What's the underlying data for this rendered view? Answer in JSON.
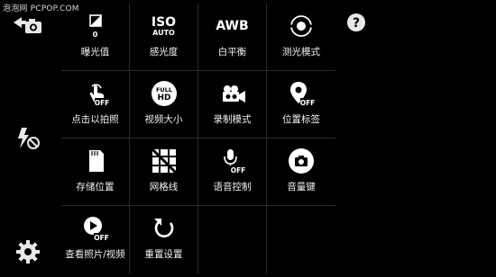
{
  "watermark": "泡泡网 PCPOP.COM",
  "sidebar": {
    "switch_camera": "switch-camera-icon",
    "flash": "flash-off-icon",
    "settings": "settings-icon"
  },
  "help": "help-icon",
  "settings_grid": [
    {
      "label": "曝光值",
      "icon": "exposure-icon",
      "value_text": "0"
    },
    {
      "label": "感光度",
      "icon": "iso-icon",
      "icon_text": "ISO",
      "value_text": "AUTO"
    },
    {
      "label": "白平衡",
      "icon": "white-balance-icon",
      "icon_text": "AWB"
    },
    {
      "label": "测光模式",
      "icon": "metering-icon"
    },
    {
      "label": "点击以拍照",
      "icon": "touch-capture-icon",
      "badge": "OFF"
    },
    {
      "label": "视频大小",
      "icon": "video-size-icon",
      "icon_text": "FULL",
      "value_text": "HD"
    },
    {
      "label": "录制模式",
      "icon": "recording-mode-icon"
    },
    {
      "label": "位置标签",
      "icon": "location-tag-icon",
      "badge": "OFF"
    },
    {
      "label": "存储位置",
      "icon": "storage-icon"
    },
    {
      "label": "网格线",
      "icon": "grid-lines-icon"
    },
    {
      "label": "语音控制",
      "icon": "voice-control-icon",
      "badge": "OFF"
    },
    {
      "label": "音量键",
      "icon": "volume-key-icon"
    },
    {
      "label": "查看照片/视频",
      "icon": "review-icon",
      "badge": "OFF"
    },
    {
      "label": "重置设置",
      "icon": "reset-icon"
    }
  ]
}
